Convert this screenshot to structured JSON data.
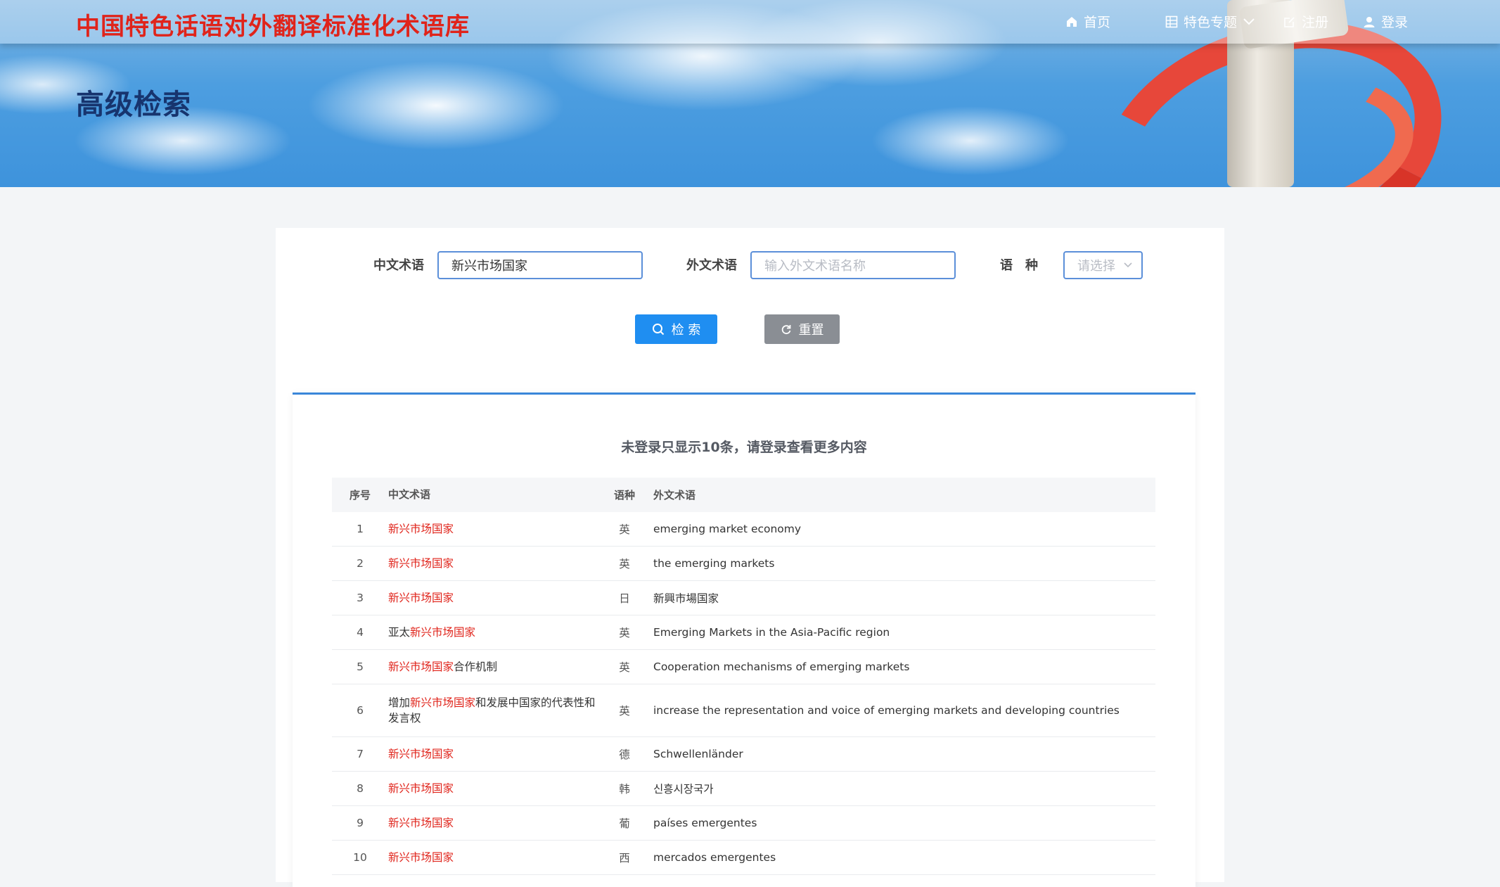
{
  "header": {
    "site_title": "中国特色话语对外翻译标准化术语库",
    "nav": {
      "home": "首页",
      "special_topics": "特色专题",
      "register": "注册",
      "login": "登录"
    }
  },
  "banner": {
    "heading": "高级检索"
  },
  "search": {
    "cn_label": "中文术语",
    "cn_value": "新兴市场国家",
    "foreign_label": "外文术语",
    "foreign_placeholder": "输入外文术语名称",
    "lang_label": "语　种",
    "lang_placeholder": "请选择",
    "search_button": "检 索",
    "reset_button": "重置"
  },
  "results": {
    "notice": "未登录只显示10条，请登录查看更多内容",
    "columns": {
      "index": "序号",
      "cn": "中文术语",
      "lang": "语种",
      "foreign": "外文术语"
    },
    "rows": [
      {
        "index": "1",
        "cn_pre": "",
        "cn_hl": "新兴市场国家",
        "cn_post": "",
        "lang": "英",
        "foreign": "emerging market economy"
      },
      {
        "index": "2",
        "cn_pre": "",
        "cn_hl": "新兴市场国家",
        "cn_post": "",
        "lang": "英",
        "foreign": "the emerging markets"
      },
      {
        "index": "3",
        "cn_pre": "",
        "cn_hl": "新兴市场国家",
        "cn_post": "",
        "lang": "日",
        "foreign": "新興市場国家"
      },
      {
        "index": "4",
        "cn_pre": "亚太",
        "cn_hl": "新兴市场国家",
        "cn_post": "",
        "lang": "英",
        "foreign": "Emerging Markets in the Asia-Pacific region"
      },
      {
        "index": "5",
        "cn_pre": "",
        "cn_hl": "新兴市场国家",
        "cn_post": "合作机制",
        "lang": "英",
        "foreign": "Cooperation mechanisms of emerging markets"
      },
      {
        "index": "6",
        "cn_pre": "增加",
        "cn_hl": "新兴市场国家",
        "cn_post": "和发展中国家的代表性和发言权",
        "lang": "英",
        "foreign": "increase the representation and voice of emerging markets and developing countries"
      },
      {
        "index": "7",
        "cn_pre": "",
        "cn_hl": "新兴市场国家",
        "cn_post": "",
        "lang": "德",
        "foreign": "Schwellenländer"
      },
      {
        "index": "8",
        "cn_pre": "",
        "cn_hl": "新兴市场国家",
        "cn_post": "",
        "lang": "韩",
        "foreign": "신흥시장국가"
      },
      {
        "index": "9",
        "cn_pre": "",
        "cn_hl": "新兴市场国家",
        "cn_post": "",
        "lang": "葡",
        "foreign": "países emergentes"
      },
      {
        "index": "10",
        "cn_pre": "",
        "cn_hl": "新兴市场国家",
        "cn_post": "",
        "lang": "西",
        "foreign": "mercados emergentes"
      }
    ]
  }
}
